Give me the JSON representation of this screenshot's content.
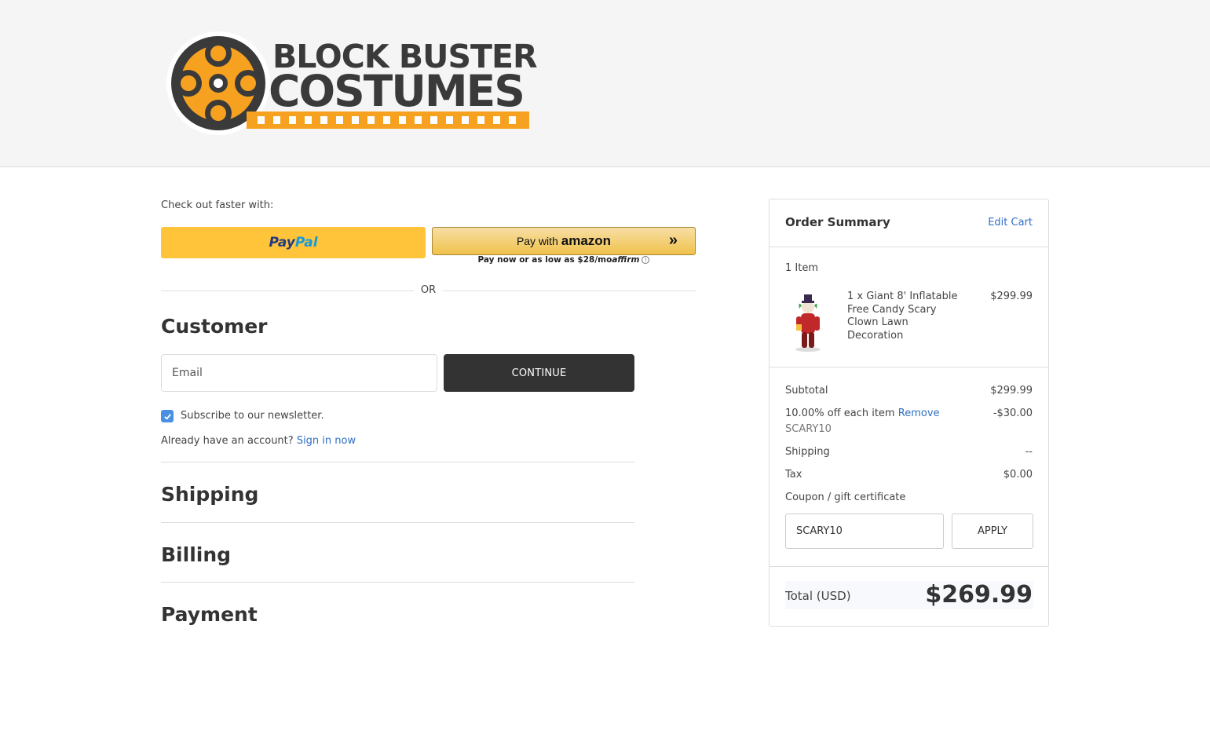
{
  "brand": {
    "line1": "BLOCK BUSTER",
    "line2": "COSTUMES",
    "colors": {
      "orange": "#f6a11f",
      "dark": "#3a3a3a"
    }
  },
  "express": {
    "label": "Check out faster with:",
    "paypal": {
      "part1": "Pay",
      "part2": "Pal"
    },
    "amazon": {
      "prefix": "Pay with",
      "brand": "amazon",
      "arrows": "»"
    },
    "affirm": {
      "text": "Pay now or as low as $28/mo",
      "brand": "affirm",
      "info": "i"
    },
    "or": "OR"
  },
  "customer": {
    "title": "Customer",
    "email_placeholder": "Email",
    "continue_label": "CONTINUE",
    "newsletter_label": "Subscribe to our newsletter.",
    "newsletter_checked": true,
    "account_prompt": "Already have an account?",
    "sign_in_link": "Sign in now"
  },
  "steps": {
    "shipping": "Shipping",
    "billing": "Billing",
    "payment": "Payment"
  },
  "summary": {
    "title": "Order Summary",
    "edit_cart": "Edit Cart",
    "item_count": "1 Item",
    "items": [
      {
        "name": "1 x Giant 8' Inflatable Free Candy Scary Clown Lawn Decoration",
        "price": "$299.99"
      }
    ],
    "subtotal_label": "Subtotal",
    "subtotal_value": "$299.99",
    "discount_label": "10.00% off each item",
    "discount_remove": "Remove",
    "discount_code": "SCARY10",
    "discount_value": "-$30.00",
    "shipping_label": "Shipping",
    "shipping_value": "--",
    "tax_label": "Tax",
    "tax_value": "$0.00",
    "coupon_link": "Coupon / gift certificate",
    "coupon_value": "SCARY10",
    "apply_label": "APPLY",
    "total_label": "Total (USD)",
    "total_value": "$269.99"
  }
}
